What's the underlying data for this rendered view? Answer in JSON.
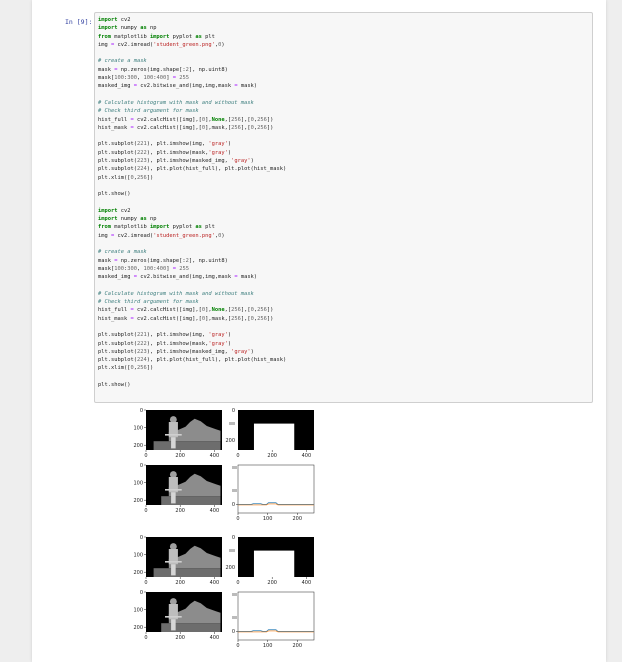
{
  "cell": {
    "prompt": "In [9]:",
    "code_lines": [
      [
        [
          "kw",
          "import"
        ],
        [
          "t",
          " cv2"
        ]
      ],
      [
        [
          "kw",
          "import"
        ],
        [
          "t",
          " numpy "
        ],
        [
          "kw",
          "as"
        ],
        [
          "t",
          " np"
        ]
      ],
      [
        [
          "kw",
          "from"
        ],
        [
          "t",
          " matplotlib "
        ],
        [
          "kw",
          "import"
        ],
        [
          "t",
          " pyplot "
        ],
        [
          "kw",
          "as"
        ],
        [
          "t",
          " plt"
        ]
      ],
      [
        [
          "t",
          "img "
        ],
        [
          "op",
          "="
        ],
        [
          "t",
          " cv2.imread("
        ],
        [
          "st",
          "'student_green.png'"
        ],
        [
          "t",
          ","
        ],
        [
          "nu",
          "0"
        ],
        [
          "t",
          ")"
        ]
      ],
      [
        [
          "t",
          ""
        ]
      ],
      [
        [
          "cm",
          "# create a mask"
        ]
      ],
      [
        [
          "t",
          "mask "
        ],
        [
          "op",
          "="
        ],
        [
          "t",
          " np.zeros(img.shape[:"
        ],
        [
          "nu",
          "2"
        ],
        [
          "t",
          "], np.uint8)"
        ]
      ],
      [
        [
          "t",
          "mask["
        ],
        [
          "nu",
          "100"
        ],
        [
          "t",
          ":"
        ],
        [
          "nu",
          "300"
        ],
        [
          "t",
          ", "
        ],
        [
          "nu",
          "100"
        ],
        [
          "t",
          ":"
        ],
        [
          "nu",
          "400"
        ],
        [
          "t",
          "] "
        ],
        [
          "op",
          "="
        ],
        [
          "t",
          " "
        ],
        [
          "nu",
          "255"
        ]
      ],
      [
        [
          "t",
          "masked_img "
        ],
        [
          "op",
          "="
        ],
        [
          "t",
          " cv2.bitwise_and(img,img,mask "
        ],
        [
          "op",
          "="
        ],
        [
          "t",
          " mask)"
        ]
      ],
      [
        [
          "t",
          ""
        ]
      ],
      [
        [
          "cm",
          "# Calculate histogram with mask and without mask"
        ]
      ],
      [
        [
          "cm",
          "# Check third argument for mask"
        ]
      ],
      [
        [
          "t",
          "hist_full "
        ],
        [
          "op",
          "="
        ],
        [
          "t",
          " cv2.calcHist([img],["
        ],
        [
          "nu",
          "0"
        ],
        [
          "t",
          "],"
        ],
        [
          "kw",
          "None"
        ],
        [
          "t",
          ",["
        ],
        [
          "nu",
          "256"
        ],
        [
          "t",
          "],["
        ],
        [
          "nu",
          "0"
        ],
        [
          "t",
          ","
        ],
        [
          "nu",
          "256"
        ],
        [
          "t",
          "])"
        ]
      ],
      [
        [
          "t",
          "hist_mask "
        ],
        [
          "op",
          "="
        ],
        [
          "t",
          " cv2.calcHist([img],["
        ],
        [
          "nu",
          "0"
        ],
        [
          "t",
          "],mask,["
        ],
        [
          "nu",
          "256"
        ],
        [
          "t",
          "],["
        ],
        [
          "nu",
          "0"
        ],
        [
          "t",
          ","
        ],
        [
          "nu",
          "256"
        ],
        [
          "t",
          "])"
        ]
      ],
      [
        [
          "t",
          ""
        ]
      ],
      [
        [
          "t",
          "plt.subplot("
        ],
        [
          "nu",
          "221"
        ],
        [
          "t",
          "), plt.imshow(img, "
        ],
        [
          "st",
          "'gray'"
        ],
        [
          "t",
          ")"
        ]
      ],
      [
        [
          "t",
          "plt.subplot("
        ],
        [
          "nu",
          "222"
        ],
        [
          "t",
          "), plt.imshow(mask,"
        ],
        [
          "st",
          "'gray'"
        ],
        [
          "t",
          ")"
        ]
      ],
      [
        [
          "t",
          "plt.subplot("
        ],
        [
          "nu",
          "223"
        ],
        [
          "t",
          "), plt.imshow(masked_img, "
        ],
        [
          "st",
          "'gray'"
        ],
        [
          "t",
          ")"
        ]
      ],
      [
        [
          "t",
          "plt.subplot("
        ],
        [
          "nu",
          "224"
        ],
        [
          "t",
          "), plt.plot(hist_full), plt.plot(hist_mask)"
        ]
      ],
      [
        [
          "t",
          "plt.xlim(["
        ],
        [
          "nu",
          "0"
        ],
        [
          "t",
          ","
        ],
        [
          "nu",
          "256"
        ],
        [
          "t",
          "])"
        ]
      ],
      [
        [
          "t",
          ""
        ]
      ],
      [
        [
          "t",
          "plt.show()"
        ]
      ],
      [
        [
          "t",
          ""
        ]
      ],
      [
        [
          "kw",
          "import"
        ],
        [
          "t",
          " cv2"
        ]
      ],
      [
        [
          "kw",
          "import"
        ],
        [
          "t",
          " numpy "
        ],
        [
          "kw",
          "as"
        ],
        [
          "t",
          " np"
        ]
      ],
      [
        [
          "kw",
          "from"
        ],
        [
          "t",
          " matplotlib "
        ],
        [
          "kw",
          "import"
        ],
        [
          "t",
          " pyplot "
        ],
        [
          "kw",
          "as"
        ],
        [
          "t",
          " plt"
        ]
      ],
      [
        [
          "t",
          "img "
        ],
        [
          "op",
          "="
        ],
        [
          "t",
          " cv2.imread("
        ],
        [
          "st",
          "'student_green.png'"
        ],
        [
          "t",
          ","
        ],
        [
          "nu",
          "0"
        ],
        [
          "t",
          ")"
        ]
      ],
      [
        [
          "t",
          ""
        ]
      ],
      [
        [
          "cm",
          "# create a mask"
        ]
      ],
      [
        [
          "t",
          "mask "
        ],
        [
          "op",
          "="
        ],
        [
          "t",
          " np.zeros(img.shape[:"
        ],
        [
          "nu",
          "2"
        ],
        [
          "t",
          "], np.uint8)"
        ]
      ],
      [
        [
          "t",
          "mask["
        ],
        [
          "nu",
          "100"
        ],
        [
          "t",
          ":"
        ],
        [
          "nu",
          "300"
        ],
        [
          "t",
          ", "
        ],
        [
          "nu",
          "100"
        ],
        [
          "t",
          ":"
        ],
        [
          "nu",
          "400"
        ],
        [
          "t",
          "] "
        ],
        [
          "op",
          "="
        ],
        [
          "t",
          " "
        ],
        [
          "nu",
          "255"
        ]
      ],
      [
        [
          "t",
          "masked_img "
        ],
        [
          "op",
          "="
        ],
        [
          "t",
          " cv2.bitwise_and(img,img,mask "
        ],
        [
          "op",
          "="
        ],
        [
          "t",
          " mask)"
        ]
      ],
      [
        [
          "t",
          ""
        ]
      ],
      [
        [
          "cm",
          "# Calculate histogram with mask and without mask"
        ]
      ],
      [
        [
          "cm",
          "# Check third argument for mask"
        ]
      ],
      [
        [
          "t",
          "hist_full "
        ],
        [
          "op",
          "="
        ],
        [
          "t",
          " cv2.calcHist([img],["
        ],
        [
          "nu",
          "0"
        ],
        [
          "t",
          "],"
        ],
        [
          "kw",
          "None"
        ],
        [
          "t",
          ",["
        ],
        [
          "nu",
          "256"
        ],
        [
          "t",
          "],["
        ],
        [
          "nu",
          "0"
        ],
        [
          "t",
          ","
        ],
        [
          "nu",
          "256"
        ],
        [
          "t",
          "])"
        ]
      ],
      [
        [
          "t",
          "hist_mask "
        ],
        [
          "op",
          "="
        ],
        [
          "t",
          " cv2.calcHist([img],["
        ],
        [
          "nu",
          "0"
        ],
        [
          "t",
          "],mask,["
        ],
        [
          "nu",
          "256"
        ],
        [
          "t",
          "],["
        ],
        [
          "nu",
          "0"
        ],
        [
          "t",
          ","
        ],
        [
          "nu",
          "256"
        ],
        [
          "t",
          "])"
        ]
      ],
      [
        [
          "t",
          ""
        ]
      ],
      [
        [
          "t",
          "plt.subplot("
        ],
        [
          "nu",
          "221"
        ],
        [
          "t",
          "), plt.imshow(img, "
        ],
        [
          "st",
          "'gray'"
        ],
        [
          "t",
          ")"
        ]
      ],
      [
        [
          "t",
          "plt.subplot("
        ],
        [
          "nu",
          "222"
        ],
        [
          "t",
          "), plt.imshow(mask,"
        ],
        [
          "st",
          "'gray'"
        ],
        [
          "t",
          ")"
        ]
      ],
      [
        [
          "t",
          "plt.subplot("
        ],
        [
          "nu",
          "223"
        ],
        [
          "t",
          "), plt.imshow(masked_img, "
        ],
        [
          "st",
          "'gray'"
        ],
        [
          "t",
          ")"
        ]
      ],
      [
        [
          "t",
          "plt.subplot("
        ],
        [
          "nu",
          "224"
        ],
        [
          "t",
          "), plt.plot(hist_full), plt.plot(hist_mask)"
        ]
      ],
      [
        [
          "t",
          "plt.xlim(["
        ],
        [
          "nu",
          "0"
        ],
        [
          "t",
          ","
        ],
        [
          "nu",
          "256"
        ],
        [
          "t",
          "])"
        ]
      ],
      [
        [
          "t",
          ""
        ]
      ],
      [
        [
          "t",
          "plt.show()"
        ]
      ]
    ]
  },
  "output": {
    "figures": [
      {
        "image_ticks": {
          "x": [
            "0",
            "200",
            "400"
          ],
          "y": [
            "0",
            "100",
            "200"
          ]
        },
        "hist_ticks": {
          "x": [
            "0",
            "100",
            "200"
          ],
          "y": [
            "0"
          ]
        }
      },
      {
        "image_ticks": {
          "x": [
            "0",
            "200",
            "400"
          ],
          "y": [
            "0",
            "100",
            "200"
          ]
        },
        "hist_ticks": {
          "x": [
            "0",
            "100",
            "200"
          ],
          "y": [
            "0"
          ]
        }
      }
    ],
    "colors": {
      "hist_full": "#1f77b4",
      "hist_mask": "#ff7f0e",
      "image_bg": "#000000",
      "mask_fg": "#ffffff"
    }
  }
}
